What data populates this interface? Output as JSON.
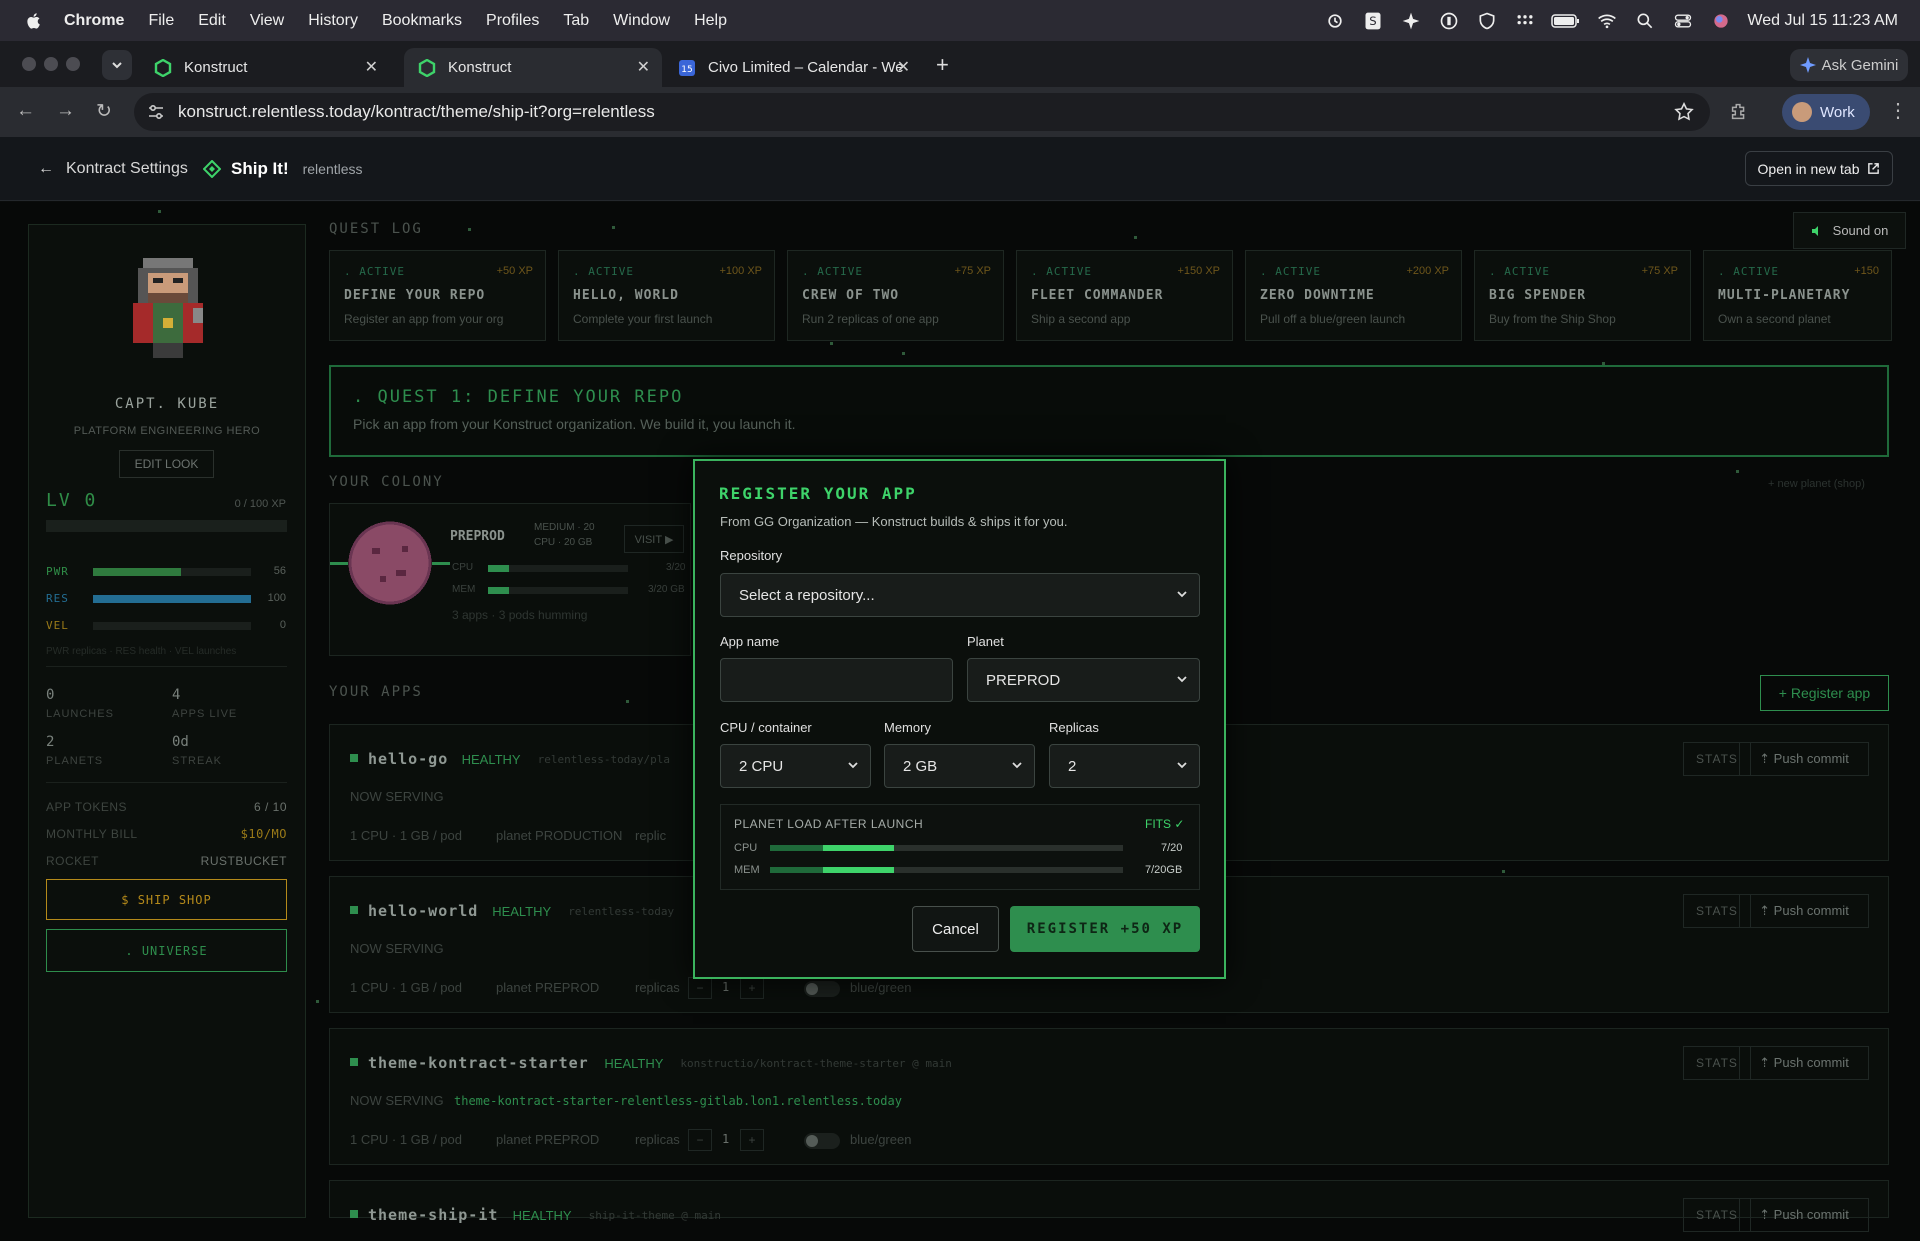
{
  "menubar": {
    "app": "Chrome",
    "items": [
      "File",
      "Edit",
      "View",
      "History",
      "Bookmarks",
      "Profiles",
      "Tab",
      "Window",
      "Help"
    ],
    "datetime": "Wed Jul 15  11:23 AM"
  },
  "browser": {
    "tabs": [
      {
        "title": "Konstruct"
      },
      {
        "title": "Konstruct"
      },
      {
        "title": "Civo Limited – Calendar - We"
      }
    ],
    "ask_gemini": "Ask Gemini",
    "url": "konstruct.relentless.today/kontract/theme/ship-it?org=relentless",
    "profile": "Work"
  },
  "header": {
    "back_label": "Kontract Settings",
    "title": "Ship It!",
    "org": "relentless",
    "open_new_tab": "Open in new tab"
  },
  "player": {
    "name": "CAPT. KUBE",
    "role": "PLATFORM ENGINEERING HERO",
    "edit_look": "EDIT LOOK",
    "level": "LV 0",
    "xp": "0 / 100 XP",
    "stats": [
      {
        "name": "PWR",
        "value": "56",
        "fraction": 0.56,
        "color": "#2f7a3e",
        "labelcolor": "#2f8c47"
      },
      {
        "name": "RES",
        "value": "100",
        "fraction": 1.0,
        "color": "#236d93",
        "labelcolor": "#236d93"
      },
      {
        "name": "VEL",
        "value": "0",
        "fraction": 0,
        "color": "#9a7a18",
        "labelcolor": "#9a7a18"
      }
    ],
    "stat_note": "PWR replicas · RES health · VEL launches",
    "launches": "0",
    "launches_label": "LAUNCHES",
    "apps_live": "4",
    "apps_live_label": "APPS LIVE",
    "planets": "2",
    "planets_label": "PLANETS",
    "streak": "0d",
    "streak_label": "STREAK",
    "app_tokens_label": "APP TOKENS",
    "app_tokens": "6 / 10",
    "monthly_bill_label": "MONTHLY BILL",
    "monthly_bill": "$10/MO",
    "rocket_label": "ROCKET",
    "rocket": "RUSTBUCKET",
    "ship_shop": "$ SHIP SHOP",
    "universe": ". UNIVERSE"
  },
  "quest_log": {
    "title": "QUEST LOG",
    "quests": [
      {
        "status": ". ACTIVE",
        "xp": "+50 XP",
        "title": "DEFINE YOUR REPO",
        "desc": "Register an app from your org"
      },
      {
        "status": ". ACTIVE",
        "xp": "+100 XP",
        "title": "HELLO, WORLD",
        "desc": "Complete your first launch"
      },
      {
        "status": ". ACTIVE",
        "xp": "+75 XP",
        "title": "CREW OF TWO",
        "desc": "Run 2 replicas of one app"
      },
      {
        "status": ". ACTIVE",
        "xp": "+150 XP",
        "title": "FLEET COMMANDER",
        "desc": "Ship a second app"
      },
      {
        "status": ". ACTIVE",
        "xp": "+200 XP",
        "title": "ZERO DOWNTIME",
        "desc": "Pull off a blue/green launch"
      },
      {
        "status": ". ACTIVE",
        "xp": "+75 XP",
        "title": "BIG SPENDER",
        "desc": "Buy from the Ship Shop"
      },
      {
        "status": ". ACTIVE",
        "xp": "+150",
        "title": "MULTI-PLANETARY",
        "desc": "Own a second planet"
      }
    ]
  },
  "sound": "Sound on",
  "current_quest": {
    "title": ". QUEST 1: DEFINE YOUR REPO",
    "desc": "Pick an app from your Konstruct organization. We build it, you launch it."
  },
  "colony": {
    "title": "YOUR COLONY",
    "new_planet": "+ new planet (shop)",
    "planet": "PREPROD",
    "size": "MEDIUM · 20",
    "cpu_gb": "CPU · 20 GB",
    "visit": "VISIT ▶",
    "cpu_label": "CPU",
    "cpu_value": "3/20",
    "cpu_fraction": 0.15,
    "mem_label": "MEM",
    "mem_value": "3/20 GB",
    "mem_fraction": 0.15,
    "summary": "3 apps · 3 pods humming"
  },
  "apps": {
    "title": "YOUR APPS",
    "register": "+ Register app",
    "stats_label": "STATS",
    "push_label": "⇡ Push commit",
    "items": [
      {
        "name": "hello-go",
        "status": "HEALTHY",
        "repo": "relentless-today/pla",
        "serving": "NOW SERVING",
        "url": "",
        "spec": "1 CPU · 1 GB / pod",
        "planet": "planet PRODUCTION",
        "replicas_label": "replic",
        "replicas": "",
        "bg": ""
      },
      {
        "name": "hello-world",
        "status": "HEALTHY",
        "repo": "relentless-today",
        "serving": "NOW SERVING",
        "url": "",
        "spec": "1 CPU · 1 GB / pod",
        "planet": "planet PREPROD",
        "replicas_label": "replicas",
        "replicas": "1",
        "bg": "blue/green"
      },
      {
        "name": "theme-kontract-starter",
        "status": "HEALTHY",
        "repo": "konstructio/kontract-theme-starter @ main",
        "serving": "NOW SERVING",
        "url": "theme-kontract-starter-relentless-gitlab.lon1.relentless.today",
        "spec": "1 CPU · 1 GB / pod",
        "planet": "planet PREPROD",
        "replicas_label": "replicas",
        "replicas": "1",
        "bg": "blue/green"
      },
      {
        "name": "theme-ship-it",
        "status": "HEALTHY",
        "repo": "ship-it-theme @ main",
        "serving": "",
        "url": "",
        "spec": "",
        "planet": "",
        "replicas_label": "",
        "replicas": "",
        "bg": ""
      }
    ]
  },
  "modal": {
    "title": "REGISTER YOUR APP",
    "subtitle": "From GG Organization — Konstruct builds & ships it for you.",
    "repository_label": "Repository",
    "repository_placeholder": "Select a repository...",
    "app_name_label": "App name",
    "app_name_value": "",
    "planet_label": "Planet",
    "planet_value": "PREPROD",
    "cpu_label": "CPU / container",
    "cpu_value": "2 CPU",
    "memory_label": "Memory",
    "memory_value": "2 GB",
    "replicas_label": "Replicas",
    "replicas_value": "2",
    "load_title": "PLANET LOAD AFTER LAUNCH",
    "fits": "FITS ✓",
    "load_cpu_label": "CPU",
    "load_cpu_value": "7/20",
    "load_cpu_existing": 0.15,
    "load_cpu_new": 0.2,
    "load_mem_label": "MEM",
    "load_mem_value": "7/20GB",
    "load_mem_existing": 0.15,
    "load_mem_new": 0.2,
    "cancel": "Cancel",
    "register": "REGISTER +50 XP"
  },
  "colors": {
    "accent": "#3ed36a",
    "gold": "#b58a1a",
    "dim_green": "#2e8e4e"
  }
}
